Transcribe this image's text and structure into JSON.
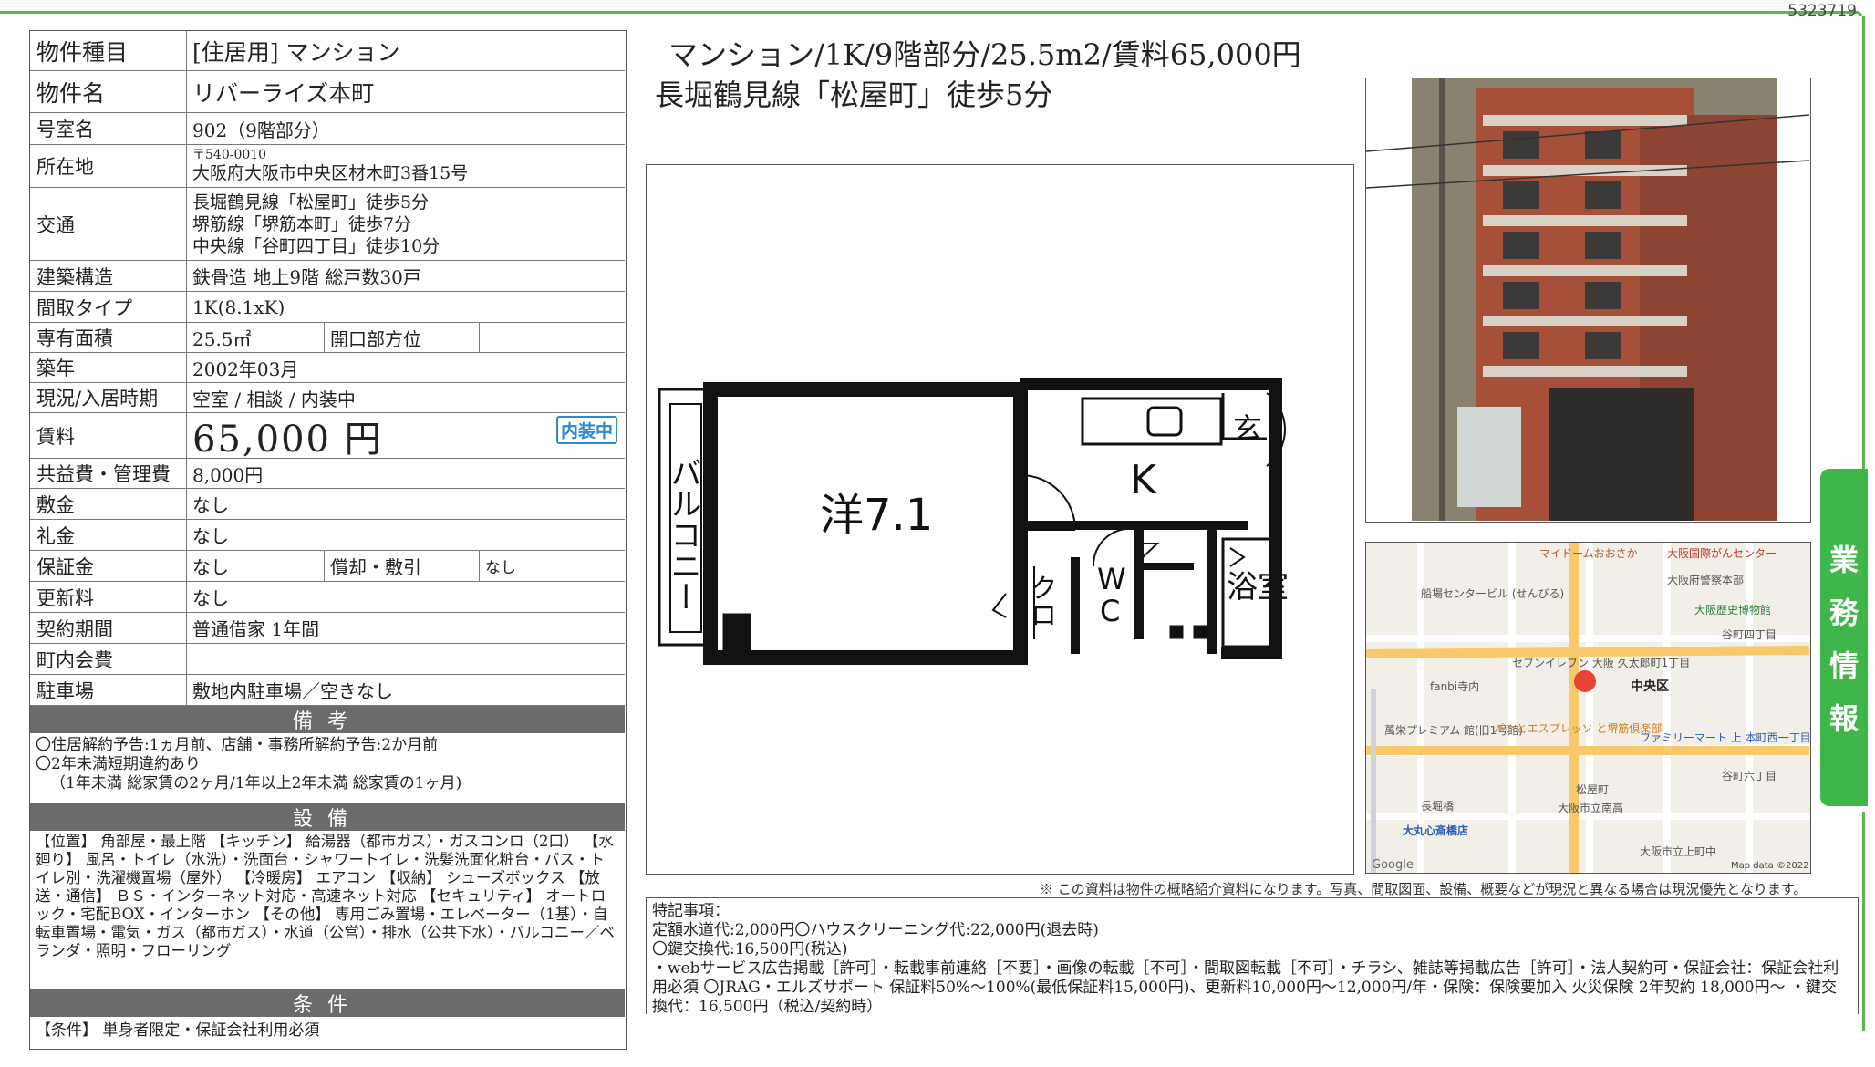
{
  "doc_id": "5323719",
  "headline": {
    "line1": "マンション/1K/9階部分/25.5m2/賃料65,000円",
    "line2": "長堀鶴見線「松屋町」徒歩5分"
  },
  "table": {
    "type_label": "物件種目",
    "type_value": "[住居用] マンション",
    "name_label": "物件名",
    "name_value": "リバーライズ本町",
    "room_label": "号室名",
    "room_value": "902（9階部分）",
    "address_label": "所在地",
    "zip": "〒540-0010",
    "address": "大阪府大阪市中央区材木町3番15号",
    "transit_label": "交通",
    "transit": [
      "長堀鶴見線「松屋町」徒歩5分",
      "堺筋線「堺筋本町」徒歩7分",
      "中央線「谷町四丁目」徒歩10分"
    ],
    "structure_label": "建築構造",
    "structure_value": "鉄骨造 地上9階 総戸数30戸",
    "layout_label": "間取タイプ",
    "layout_value": "1K(8.1xK)",
    "area_label": "専有面積",
    "area_value": "25.5㎡",
    "direction_label": "開口部方位",
    "direction_value": "",
    "built_label": "築年",
    "built_value": "2002年03月",
    "status_label": "現況/入居時期",
    "status_value": "空室 / 相談 / 内装中",
    "rent_label": "賃料",
    "rent_value": "65,000 円",
    "badge": "内装中",
    "fee_label": "共益費・管理費",
    "fee_value": "8,000円",
    "deposit_label": "敷金",
    "deposit_value": "なし",
    "key_money_label": "礼金",
    "key_money_value": "なし",
    "guarantee_label": "保証金",
    "guarantee_value": "なし",
    "amort_label": "償却・敷引",
    "amort_value": "なし",
    "renewal_label": "更新料",
    "renewal_value": "なし",
    "contract_label": "契約期間",
    "contract_value": "普通借家 1年間",
    "assoc_label": "町内会費",
    "assoc_value": "",
    "parking_label": "駐車場",
    "parking_value": "敷地内駐車場／空きなし"
  },
  "remarks": {
    "head": "備考",
    "lines": [
      "〇住居解約予告:1ヵ月前、店舗・事務所解約予告:2か月前",
      "〇2年未満短期違約あり",
      "（1年未満 総家賃の2ヶ月/1年以上2年未満 総家賃の1ヶ月)"
    ]
  },
  "facilities": {
    "head": "設備",
    "text": "【位置】 角部屋・最上階 【キッチン】 給湯器（都市ガス）・ガスコンロ（2口） 【水廻り】 風呂・トイレ（水洗）・洗面台・シャワートイレ・洗髪洗面化粧台・バス・トイレ別・洗濯機置場（屋外） 【冷暖房】 エアコン 【収納】 シューズボックス 【放送・通信】 ＢＳ・インターネット対応・高速ネット対応 【セキュリティ】 オートロック・宅配BOX・インターホン 【その他】 専用ごみ置場・エレベーター（1基）・自転車置場・電気・ガス（都市ガス）・水道（公営）・排水（公共下水）・バルコニー／ベランダ・照明・フローリング"
  },
  "conditions": {
    "head": "条件",
    "text": "【条件】 単身者限定・保証会社利用必須"
  },
  "floorplan": {
    "balcony": "バルコニー",
    "western_room": "洋7.1",
    "kitchen": "K",
    "entrance": "玄",
    "bath": "浴室",
    "closet": "クロ",
    "wc_w": "W",
    "wc_c": "C"
  },
  "map": {
    "labels": [
      "マイドームおおさか",
      "大阪国際がんセンター",
      "大阪府警察本部",
      "船場センタービル (せんびる)",
      "大阪歴史博物館",
      "谷町四丁目",
      "セブンイレブン 大阪 久太郎町1丁目",
      "中央区",
      "fanbi寺内",
      "萬栄プレミアム 館(旧1号館)",
      "パンとエスプレッソ と堺筋倶楽部",
      "ファミリーマート 上 本町西一丁目店",
      "谷町六丁目",
      "長堀橋",
      "松屋町",
      "大丸心斎橋店",
      "大阪市立南高",
      "大阪市立上町中",
      "Google",
      "Map data ©2022"
    ]
  },
  "note_small": "※ この資料は物件の概略紹介資料になります。写真、間取図面、設備、概要などが現況と異なる場合は現況優先となります。",
  "notes": {
    "lines": [
      "特記事項：",
      "定額水道代:2,000円〇ハウスクリーニング代:22,000円(退去時)",
      "〇鍵交換代:16,500円(税込)",
      "・webサービス広告掲載［許可］・転載事前連絡［不要］・画像の転載［不可］・間取図転載［不可］・チラシ、雑誌等掲載広告［許可］・法人契約可・保証会社：保証会社利用必須 〇JRAG・エルズサポート 保証料50%～100%(最低保証料15,000円)、更新料10,000円～12,000円/年・保険：保険要加入 火災保険 2年契約 18,000円～ ・鍵交換代：16,500円（税込/契約時）"
    ]
  },
  "side_tab": [
    "業",
    "務",
    "情",
    "報"
  ],
  "colors": {
    "accent_green": "#57b847",
    "tab_green": "#3fb64a",
    "header_gray": "#6b6b6b",
    "badge_blue": "#3388cc"
  }
}
